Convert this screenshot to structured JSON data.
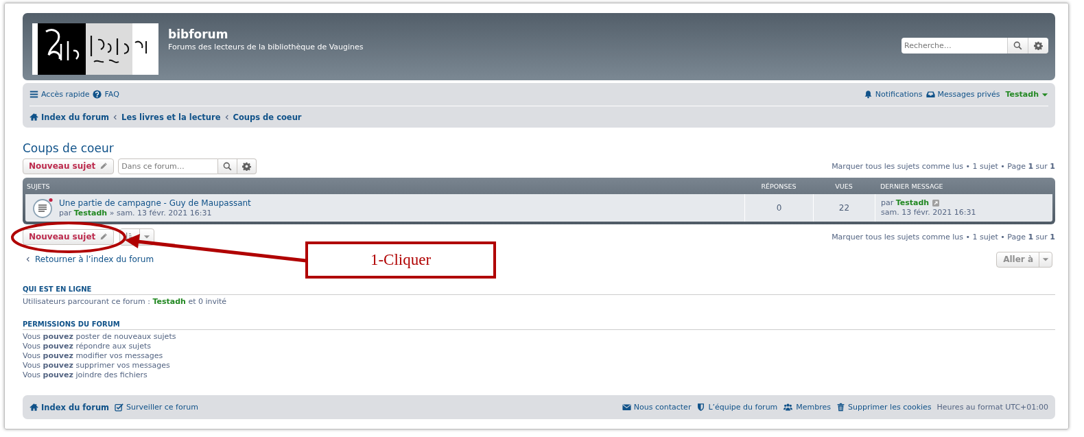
{
  "header": {
    "site_title": "bibforum",
    "site_description": "Forums des lecteurs de la bibliothèque de Vaugines",
    "search_placeholder": "Recherche…"
  },
  "navbar": {
    "quick_links": [
      {
        "kind": "menu",
        "label": "Accès rapide"
      },
      {
        "kind": "help",
        "label": "FAQ"
      }
    ],
    "user_links": [
      {
        "kind": "bell",
        "label": "Notifications"
      },
      {
        "kind": "inbox",
        "label": "Messages privés"
      }
    ],
    "username": "Testadh"
  },
  "breadcrumbs": [
    "Index du forum",
    "Les livres et la lecture",
    "Coups de coeur"
  ],
  "page_title": "Coups de coeur",
  "top_toolbar": {
    "new_topic": "Nouveau sujet",
    "forum_search_placeholder": "Dans ce forum…",
    "mark_read": "Marquer tous les sujets comme lus",
    "pagination": "• 1 sujet • Page **1** sur **1**"
  },
  "table": {
    "columns": [
      "SUJETS",
      "RÉPONSES",
      "VUES",
      "DERNIER MESSAGE"
    ],
    "rows": [
      {
        "title": "Une partie de campagne - Guy de Maupassant",
        "by": "par",
        "author": "Testadh",
        "date": "» sam. 13 févr. 2021 16:31",
        "unread": true,
        "replies": "0",
        "views": "22",
        "last_by": "par",
        "last_author": "Testadh",
        "last_date": "sam. 13 févr. 2021 16:31"
      }
    ]
  },
  "bottom_toolbar": {
    "new_topic": "Nouveau sujet",
    "mark_read": "Marquer tous les sujets comme lus",
    "pagination": "• 1 sujet • Page **1** sur **1**"
  },
  "back_link": "Retourner à l’index du forum",
  "jump_button": "Aller à",
  "online": {
    "heading": "QUI EST EN LIGNE",
    "prefix": "Utilisateurs parcourant ce forum :",
    "user": "Testadh",
    "suffix": "et 0 invité"
  },
  "permissions": {
    "heading": "PERMISSIONS DU FORUM",
    "lines": [
      "Vous **pouvez** poster de nouveaux sujets",
      "Vous **pouvez** répondre aux sujets",
      "Vous **pouvez** modifier vos messages",
      "Vous **pouvez** supprimer vos messages",
      "Vous **pouvez** joindre des fichiers"
    ]
  },
  "footer": {
    "left": [
      {
        "kind": "home",
        "label": "Index du forum"
      },
      {
        "kind": "check",
        "label": "Surveiller ce forum"
      }
    ],
    "right": [
      {
        "kind": "mail",
        "label": "Nous contacter"
      },
      {
        "kind": "shield",
        "label": "L’équipe du forum"
      },
      {
        "kind": "users",
        "label": "Membres"
      },
      {
        "kind": "trash",
        "label": "Supprimer les cookies"
      }
    ],
    "timezone": "Heures au format UTC+01:00"
  },
  "annotation": {
    "callout": "1-Cliquer"
  }
}
